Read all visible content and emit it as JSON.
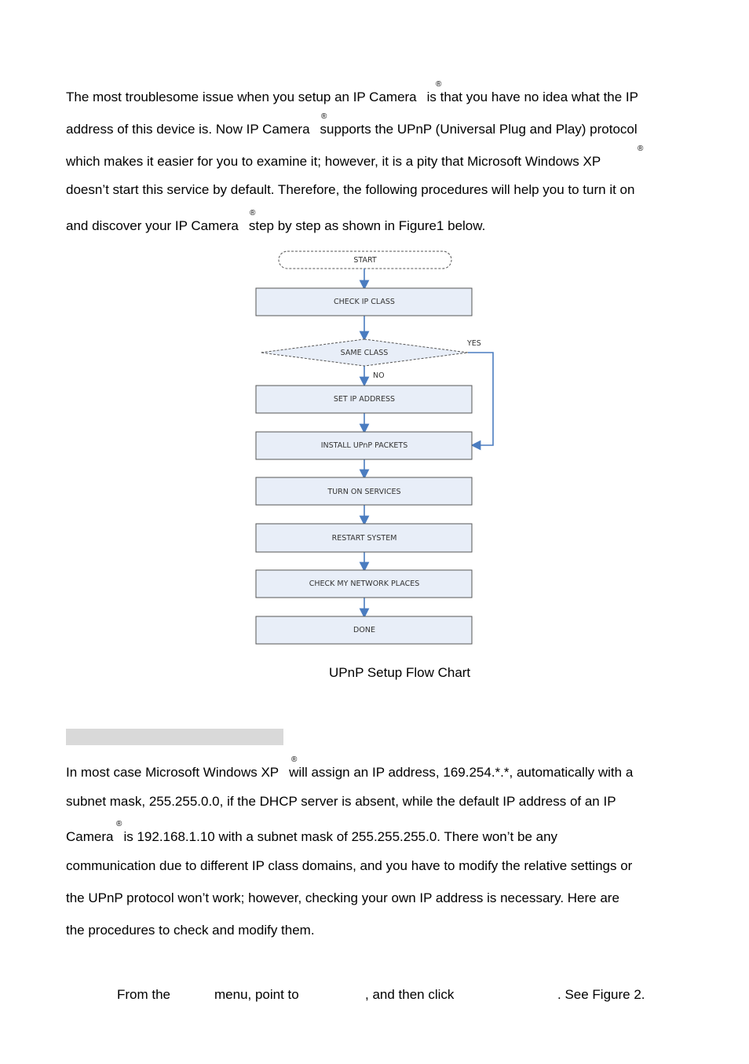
{
  "intro": {
    "lines": [
      "The most troublesome issue when you setup an IP Camera",
      "is that you have no idea what the IP",
      "address of this device is. Now IP Camera",
      "supports the UPnP (Universal Plug and Play) protocol",
      "which makes it easier for you to examine it; however, it is a pity that Microsoft Windows XP",
      "doesn’t start this service by default. Therefore, the following procedures will help you to turn it on",
      "and discover your IP Camera",
      "step by step as shown in Figure1 below."
    ],
    "registered_mark": "®"
  },
  "flowchart": {
    "start": "START",
    "steps": [
      "CHECK IP CLASS",
      "SAME CLASS",
      "SET IP ADDRESS",
      "INSTALL UPnP PACKETS",
      "TURN ON SERVICES",
      "RESTART SYSTEM",
      "CHECK MY NETWORK PLACES",
      "DONE"
    ],
    "decision_yes": "YES",
    "decision_no": "NO",
    "colors": {
      "box_fill": "#e8eef8",
      "box_stroke": "#555555",
      "arrow": "#4a7cc0"
    }
  },
  "caption": "UPnP Setup Flow Chart",
  "section": {
    "lines": [
      "In most case Microsoft Windows XP",
      "will assign an IP address, 169.254.*.*, automatically with a",
      "subnet mask, 255.255.0.0, if the DHCP server is absent, while the default IP address of an IP",
      "Camera",
      "is 192.168.1.10 with a subnet mask of 255.255.255.0. There won’t be any",
      "communication due to different IP class domains, and you have to modify the relative settings or",
      "the UPnP protocol won’t work; however, checking your own IP address is necessary. Here are",
      "the procedures to check and modify them."
    ]
  },
  "step": {
    "parts": [
      "From the",
      "menu, point to",
      ", and then click",
      ". See Figure 2."
    ]
  }
}
